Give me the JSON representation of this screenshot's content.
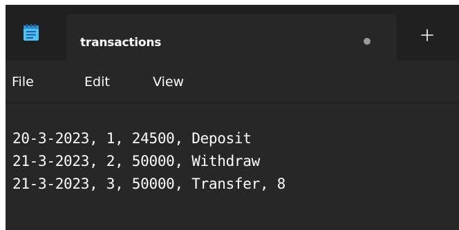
{
  "window": {
    "tab": {
      "title": "transactions",
      "unsaved": true
    },
    "icons": {
      "app": "notepad-icon",
      "new_tab": "plus-icon"
    }
  },
  "menu": {
    "file": "File",
    "edit": "Edit",
    "view": "View"
  },
  "editor": {
    "lines": [
      "20-3-2023, 1, 24500, Deposit",
      "21-3-2023, 2, 50000, Withdraw",
      "21-3-2023, 3, 50000, Transfer, 8"
    ]
  },
  "colors": {
    "titlebar": "#202020",
    "surface": "#272727",
    "text": "#ffffff",
    "accent": "#4cc2ff"
  }
}
